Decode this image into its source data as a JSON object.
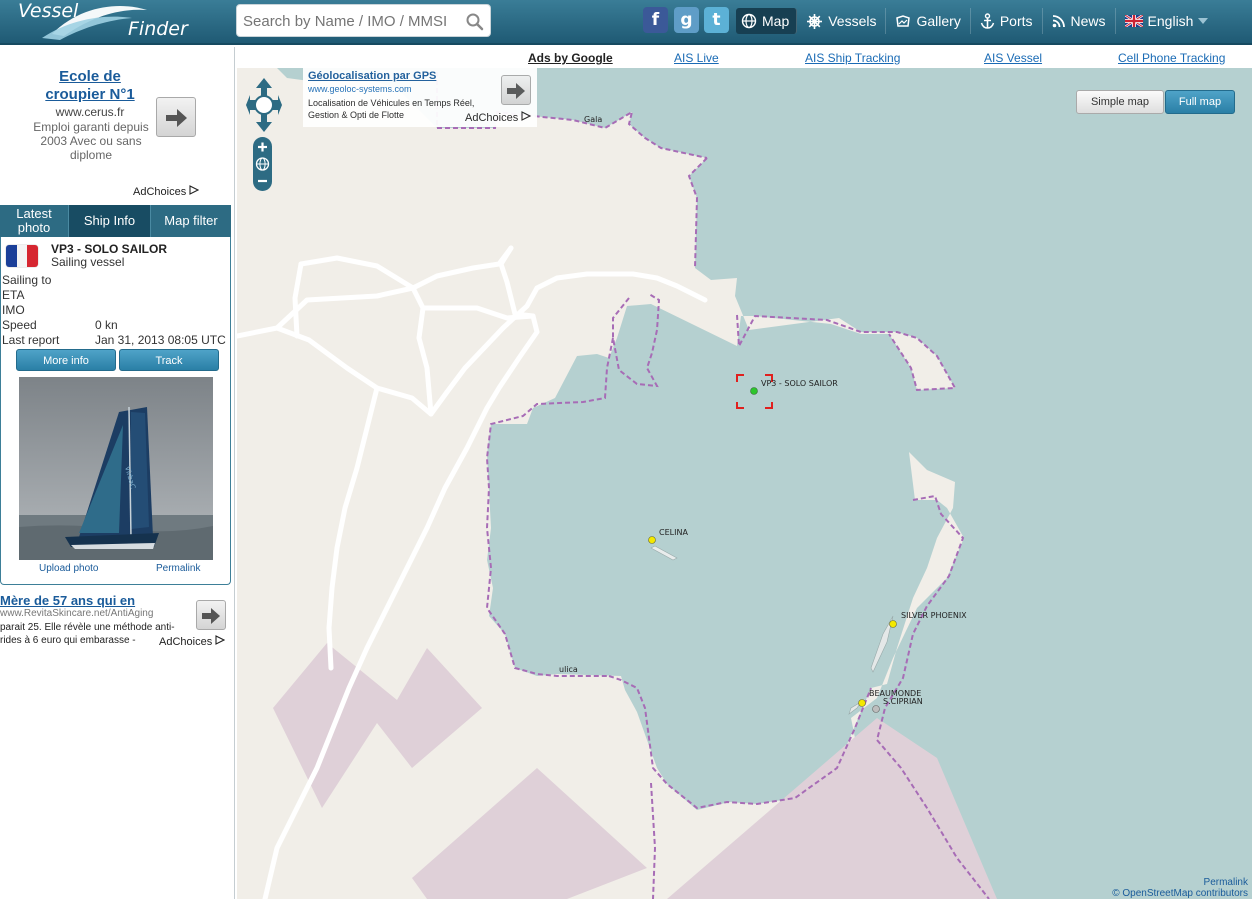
{
  "header": {
    "logo_line1": "Vessel",
    "logo_line2": "Finder",
    "search_placeholder": "Search by Name / IMO / MMSI",
    "social": [
      "f",
      "g",
      "t"
    ],
    "nav": [
      {
        "label": "Map",
        "icon": "globe-icon"
      },
      {
        "label": "Vessels",
        "icon": "helm-icon"
      },
      {
        "label": "Gallery",
        "icon": "gallery-icon"
      },
      {
        "label": "Ports",
        "icon": "anchor-icon"
      },
      {
        "label": "News",
        "icon": "rss-icon"
      },
      {
        "label": "English",
        "icon": "uk-flag-icon"
      }
    ]
  },
  "sidebar": {
    "ad1": {
      "title": "Ecole de croupier N°1",
      "url": "www.cerus.fr",
      "desc": "Emploi garanti depuis 2003 Avec ou sans diplome",
      "adchoices": "AdChoices"
    },
    "tabs": [
      "Latest photo",
      "Ship Info",
      "Map filter"
    ],
    "ship": {
      "name": "VP3 - SOLO SAILOR",
      "type": "Sailing vessel",
      "fields": [
        {
          "label": "Sailing to",
          "value": ""
        },
        {
          "label": "ETA",
          "value": ""
        },
        {
          "label": "IMO",
          "value": ""
        },
        {
          "label": "Speed",
          "value": "0 kn"
        },
        {
          "label": "Last report",
          "value": "Jan 31, 2013 08:05 UTC"
        }
      ],
      "more_info": "More info",
      "track": "Track",
      "upload_photo": "Upload photo",
      "permalink": "Permalink"
    },
    "ad2": {
      "title": "Mère de 57 ans qui en",
      "url": "www.RevitaSkincare.net/AntiAging",
      "desc": "parait 25. Elle révèle une méthode anti-rides à 6 euro qui embarasse -",
      "adchoices": "AdChoices"
    }
  },
  "map": {
    "ads_by_google": "Ads by Google",
    "ad_links": [
      "AIS Live",
      "AIS Ship Tracking",
      "AIS Vessel",
      "Cell Phone Tracking"
    ],
    "inline_ad": {
      "title": "Géolocalisation par GPS",
      "url": "www.geoloc-systems.com",
      "desc": "Localisation de Véhicules en Temps Réel, Gestion & Opti de Flotte",
      "adchoices": "AdChoices"
    },
    "simple_map": "Simple map",
    "full_map": "Full map",
    "vessels": [
      "VP3 - SOLO SAILOR",
      "CELINA",
      "SILVER PHOENIX",
      "BEAUMONDE",
      "S.CIPRIAN"
    ],
    "place_labels": [
      "Gala",
      "ulica"
    ],
    "permalink": "Permalink",
    "attribution": "© OpenStreetMap contributors"
  },
  "colors": {
    "header": "#2a6d88",
    "water": "#b5d0d0",
    "land": "#f1eee8",
    "industrial": "#dfd0d8",
    "selected_vessel": "#2cc52c",
    "vessel": "#f4e800",
    "selection_box": "#e0201e"
  }
}
